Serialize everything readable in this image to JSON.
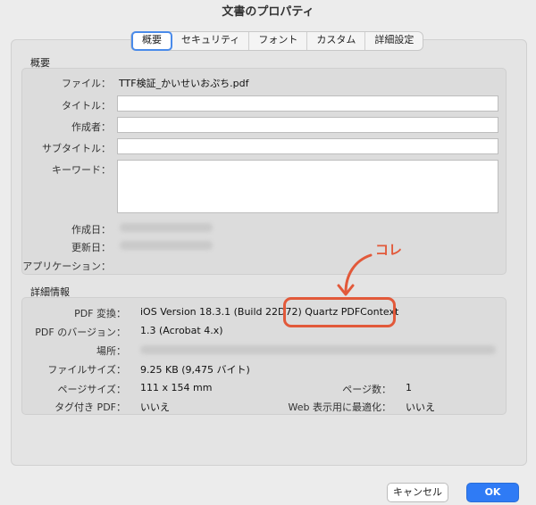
{
  "window": {
    "title": "文書のプロパティ"
  },
  "tabs": [
    "概要",
    "セキュリティ",
    "フォント",
    "カスタム",
    "詳細設定"
  ],
  "summary": {
    "section_label": "概要",
    "file_label": "ファイル：",
    "file_value": "TTF検証_かいせいおぷち.pdf",
    "title_label": "タイトル：",
    "author_label": "作成者：",
    "subtitle_label": "サブタイトル：",
    "keywords_label": "キーワード：",
    "created_label": "作成日：",
    "modified_label": "更新日：",
    "application_label": "アプリケーション："
  },
  "details": {
    "section_label": "詳細情報",
    "producer_label": "PDF 変換：",
    "producer_value": "iOS Version 18.3.1 (Build 22D72) Quartz PDFContext",
    "version_label": "PDF のバージョン：",
    "version_value": "1.3 (Acrobat 4.x)",
    "location_label": "場所：",
    "filesize_label": "ファイルサイズ：",
    "filesize_value": "9.25 KB (9,475 バイト)",
    "pagesize_label": "ページサイズ：",
    "pagesize_value": "111 x 154 mm",
    "pagecount_label": "ページ数：",
    "pagecount_value": "1",
    "tagged_label": "タグ付き PDF：",
    "tagged_value": "いいえ",
    "fastweb_label": "Web 表示用に最適化：",
    "fastweb_value": "いいえ"
  },
  "annotation": {
    "text": "コレ",
    "color": "#e2593a"
  },
  "buttons": {
    "cancel": "キャンセル",
    "ok": "OK"
  },
  "colors": {
    "accent": "#2f7bf5"
  }
}
